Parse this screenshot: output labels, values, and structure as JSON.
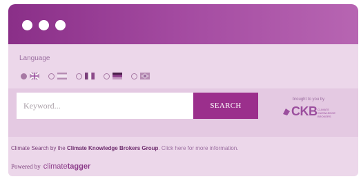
{
  "window": {
    "controls": [
      "dot",
      "dot",
      "dot"
    ]
  },
  "language": {
    "label": "Language",
    "options": [
      {
        "flag": "uk-flag",
        "selected": true
      },
      {
        "flag": "spain-flag",
        "selected": false
      },
      {
        "flag": "france-flag",
        "selected": false
      },
      {
        "flag": "germany-flag",
        "selected": false
      },
      {
        "flag": "brazil-flag",
        "selected": false
      }
    ]
  },
  "search": {
    "placeholder": "Keyword...",
    "button_label": "SEARCH"
  },
  "sponsor": {
    "brought_by": "brought to you by",
    "logo_text": "CKB",
    "logo_subtext": "CLIMATE KNOWLEDGE BROKERS"
  },
  "footer": {
    "line_prefix": "Climate Search by the ",
    "line_org": "Climate Knowledge Brokers Group",
    "line_link": ". Click here for more information.",
    "powered_label": "Powered by",
    "tagger_light": "climate",
    "tagger_bold": "tagger"
  },
  "colors": {
    "accent": "#9b2f8c",
    "titlebar": "#a44ba1",
    "panel": "#ecd7ea"
  }
}
